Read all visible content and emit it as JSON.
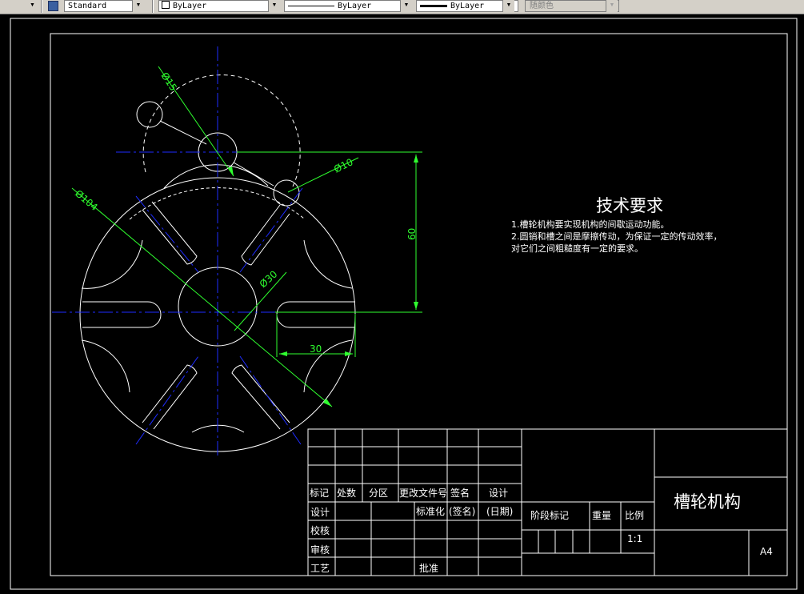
{
  "toolbar": {
    "text_style": "Standard",
    "layer_color": "ByLayer",
    "linetype": "ByLayer",
    "lineweight": "ByLayer",
    "plot_style": "随颜色"
  },
  "drawing": {
    "dims": {
      "d15": "Ø15",
      "d10": "Ø10",
      "d104": "Ø104",
      "d30": "Ø30",
      "v60": "60",
      "h30": "30"
    },
    "tech": {
      "title": "技术要求",
      "line1": "1.槽轮机构要实现机构的间歇运动功能。",
      "line2": "2.圆销和槽之间是摩擦传动，为保证一定的传动效率，",
      "line3": "对它们之间粗糙度有一定的要求。"
    },
    "title_block": {
      "row_headers": [
        "标记",
        "处数",
        "分区",
        "更改文件号",
        "签名",
        "设计"
      ],
      "design": "设计",
      "standardize": "标准化",
      "sign": "(签名)",
      "date": "(日期)",
      "check": "校核",
      "review": "审核",
      "process": "工艺",
      "approve": "批准",
      "stage_mark": "阶段标记",
      "weight": "重量",
      "ratio": "比例",
      "ratio_value": "1:1",
      "drawing_name": "槽轮机构",
      "sheet_size": "A4"
    }
  }
}
